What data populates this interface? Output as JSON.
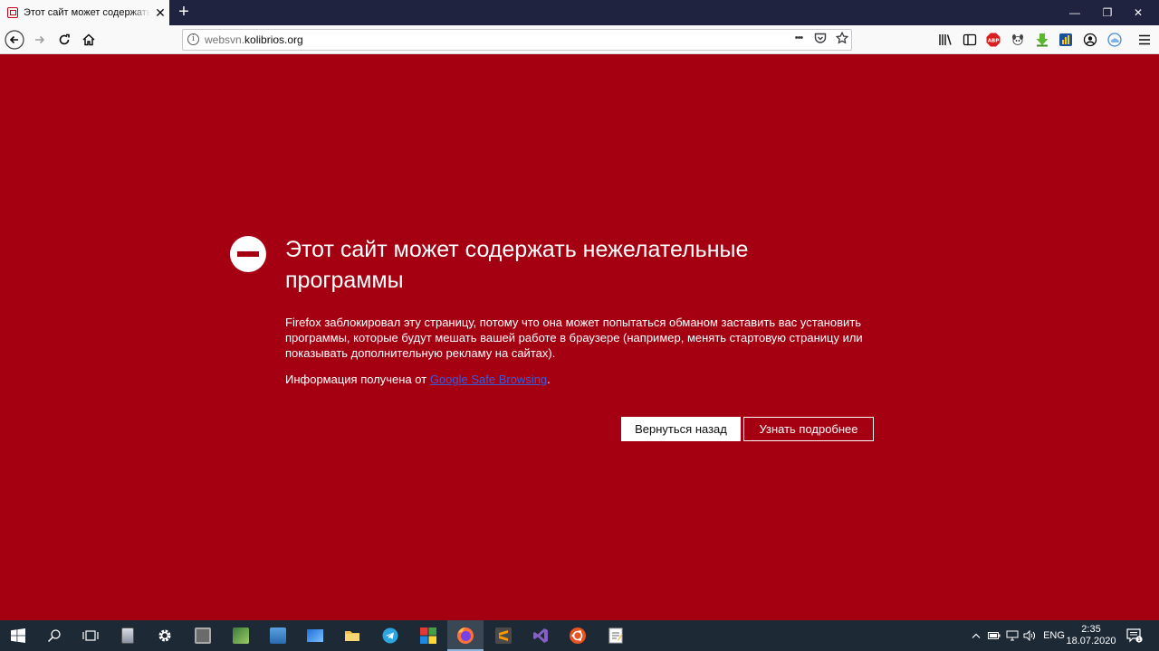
{
  "tab": {
    "title": "Этот сайт может содержать нежелательные программы",
    "close_glyph": "✕",
    "newtab_glyph": "+"
  },
  "window_controls": {
    "minimize": "—",
    "restore": "❐",
    "close": "✕"
  },
  "navbar": {
    "url_host_prefix": "websvn.",
    "url_host_main": "kolibrios.org",
    "page_actions": "•••",
    "extensions": [
      "library-icon",
      "sidebar-icon",
      "adblock-plus-icon",
      "dog-extension-icon",
      "green-arrow-extension-icon",
      "blue-square-extension-icon",
      "account-icon",
      "cloud-extension-icon",
      "menu-icon"
    ],
    "abp_label": "ABP"
  },
  "error": {
    "title": "Этот сайт может содержать нежелательные программы",
    "description": "Firefox заблокировал эту страницу, потому что она может попытаться обманом заставить вас установить программы, которые будут мешать вашей работе в браузере (например, менять стартовую страницу или показывать дополнительную рекламу на сайтах).",
    "source_prefix": "Информация получена от ",
    "source_link": "Google Safe Browsing",
    "source_suffix": ".",
    "back_button": "Вернуться назад",
    "more_button": "Узнать подробнее",
    "background_color": "#a50012"
  },
  "taskbar": {
    "apps": [
      "windows-start",
      "search",
      "task-view",
      "app-1",
      "settings",
      "app-3",
      "app-4",
      "app-5",
      "app-6",
      "file-explorer",
      "telegram",
      "app-tiles",
      "firefox",
      "sublime-text",
      "visual-studio",
      "ubuntu",
      "notepad"
    ],
    "language": "ENG",
    "time": "2:35",
    "date": "18.07.2020",
    "notification_count": "1"
  }
}
